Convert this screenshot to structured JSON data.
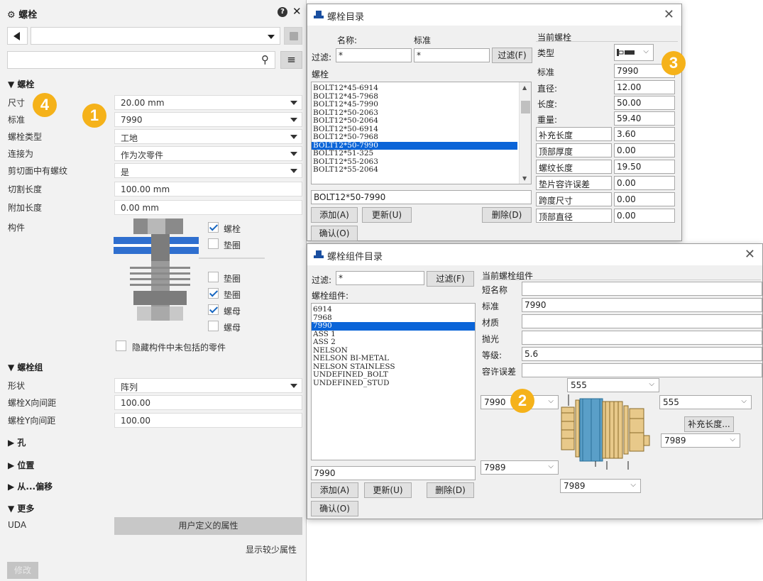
{
  "left_panel": {
    "title": "螺栓",
    "help_icon": "?",
    "close_icon": "✕",
    "search_icon": "⚲",
    "menu_icon": "≡",
    "section_bolt": "▼ 螺栓",
    "fields": [
      {
        "label": "尺寸",
        "value": "20.00 mm",
        "dropdown": true
      },
      {
        "label": "标准",
        "value": "7990",
        "dropdown": true
      },
      {
        "label": "螺栓类型",
        "value": "工地",
        "dropdown": true
      },
      {
        "label": "连接为",
        "value": "作为次零件",
        "dropdown": true
      },
      {
        "label": "剪切面中有螺纹",
        "value": "是",
        "dropdown": true
      },
      {
        "label": "切割长度",
        "value": "100.00 mm",
        "dropdown": false
      },
      {
        "label": "附加长度",
        "value": "0.00 mm",
        "dropdown": false
      }
    ],
    "components_label": "构件",
    "checkboxes": [
      {
        "label": "螺栓",
        "checked": true
      },
      {
        "label": "垫圈",
        "checked": false
      },
      {
        "label": "垫圈",
        "checked": false
      },
      {
        "label": "垫圈",
        "checked": true
      },
      {
        "label": "螺母",
        "checked": true
      },
      {
        "label": "螺母",
        "checked": false
      }
    ],
    "hide_label": "隐藏构件中未包括的零件",
    "section_group": "▼ 螺栓组",
    "group_fields": [
      {
        "label": "形状",
        "value": "阵列",
        "dropdown": true
      },
      {
        "label": "螺栓X向间距",
        "value": "100.00",
        "dropdown": false
      },
      {
        "label": "螺栓Y向间距",
        "value": "100.00",
        "dropdown": false
      }
    ],
    "section_hole": "▶ 孔",
    "section_position": "▶ 位置",
    "section_offset": "▶ 从...偏移",
    "section_more": "▼ 更多",
    "uda_label": "UDA",
    "uda_button": "用户定义的属性",
    "show_less": "显示较少属性",
    "modify_button": "修改"
  },
  "badges": [
    "1",
    "2",
    "3",
    "4"
  ],
  "bolt_catalog": {
    "title": "螺栓目录",
    "close": "✕",
    "col_name": "名称:",
    "col_standard": "标准",
    "filter_label": "过滤:",
    "filter_name": "*",
    "filter_standard": "*",
    "filter_button": "过滤(F)",
    "list_label": "螺栓",
    "items": [
      "BOLT12*45-6914",
      "BOLT12*45-7968",
      "BOLT12*45-7990",
      "BOLT12*50-2063",
      "BOLT12*50-2064",
      "BOLT12*50-6914",
      "BOLT12*50-7968",
      "BOLT12*50-7990",
      "BOLT12*51-325",
      "BOLT12*55-2063",
      "BOLT12*55-2064"
    ],
    "selected_index": 7,
    "selected_value": "BOLT12*50-7990",
    "add_button": "添加(A)",
    "update_button": "更新(U)",
    "delete_button": "删除(D)",
    "ok_button": "确认(O)",
    "current_title": "当前螺栓",
    "type_label": "类型",
    "props": [
      {
        "label": "标准",
        "value": "7990"
      },
      {
        "label": "直径:",
        "value": "12.00"
      },
      {
        "label": "长度:",
        "value": "50.00"
      },
      {
        "label": "重量:",
        "value": "59.40"
      }
    ],
    "boxed_props": [
      {
        "label": "补充长度",
        "value": "3.60"
      },
      {
        "label": "顶部厚度",
        "value": "0.00"
      },
      {
        "label": "螺纹长度",
        "value": "19.50"
      },
      {
        "label": "垫片容许误差",
        "value": "0.00"
      },
      {
        "label": "跨度尺寸",
        "value": "0.00"
      },
      {
        "label": "顶部直径",
        "value": "0.00"
      }
    ]
  },
  "assembly_catalog": {
    "title": "螺栓组件目录",
    "close": "✕",
    "filter_label": "过滤:",
    "filter_value": "*",
    "filter_button": "过滤(F)",
    "list_label": "螺栓组件:",
    "items": [
      "6914",
      "7968",
      "7990",
      "ASS 1",
      "ASS 2",
      "NELSON",
      "NELSON BI-METAL",
      "NELSON STAINLESS",
      "UNDEFINED_BOLT",
      "UNDEFINED_STUD"
    ],
    "selected_index": 2,
    "selected_value": "7990",
    "add_button": "添加(A)",
    "update_button": "更新(U)",
    "delete_button": "删除(D)",
    "ok_button": "确认(O)",
    "current_title": "当前螺栓组件",
    "props": [
      {
        "label": "短名称",
        "value": ""
      },
      {
        "label": "标准",
        "value": "7990"
      },
      {
        "label": "材质",
        "value": ""
      },
      {
        "label": "抛光",
        "value": ""
      },
      {
        "label": "等级:",
        "value": "5.6"
      },
      {
        "label": "容许误差",
        "value": ""
      }
    ],
    "combo_top": "555",
    "combo_left": "7990",
    "combo_right": "555",
    "extra_length_button": "补充长度...",
    "combo_right2": "7989",
    "combo_bottom_left": "7989",
    "combo_bottom": "7989"
  },
  "colors": {
    "accent": "#0a64d8",
    "badge": "#f5b21a",
    "plate_blue": "#2f6fcf"
  }
}
